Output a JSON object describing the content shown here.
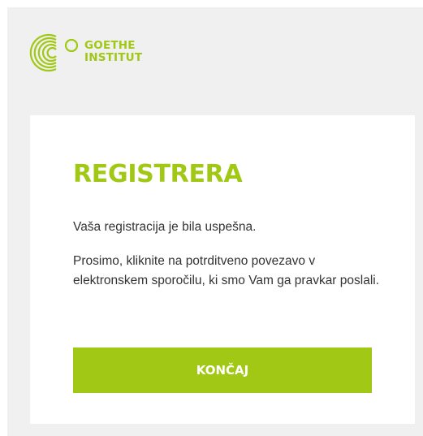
{
  "brand": {
    "logo_icon": "goethe-logo-icon",
    "line1": "GOETHE",
    "line2": "INSTITUT",
    "color": "#a0c814"
  },
  "card": {
    "title": "REGISTRERA",
    "message1": "Vaša registracija je bila uspešna.",
    "message2": "Prosimo, kliknite na potrditveno povezavo v elektronskem sporočilu, ki smo Vam ga pravkar poslali.",
    "button_label": "KONČAJ"
  }
}
